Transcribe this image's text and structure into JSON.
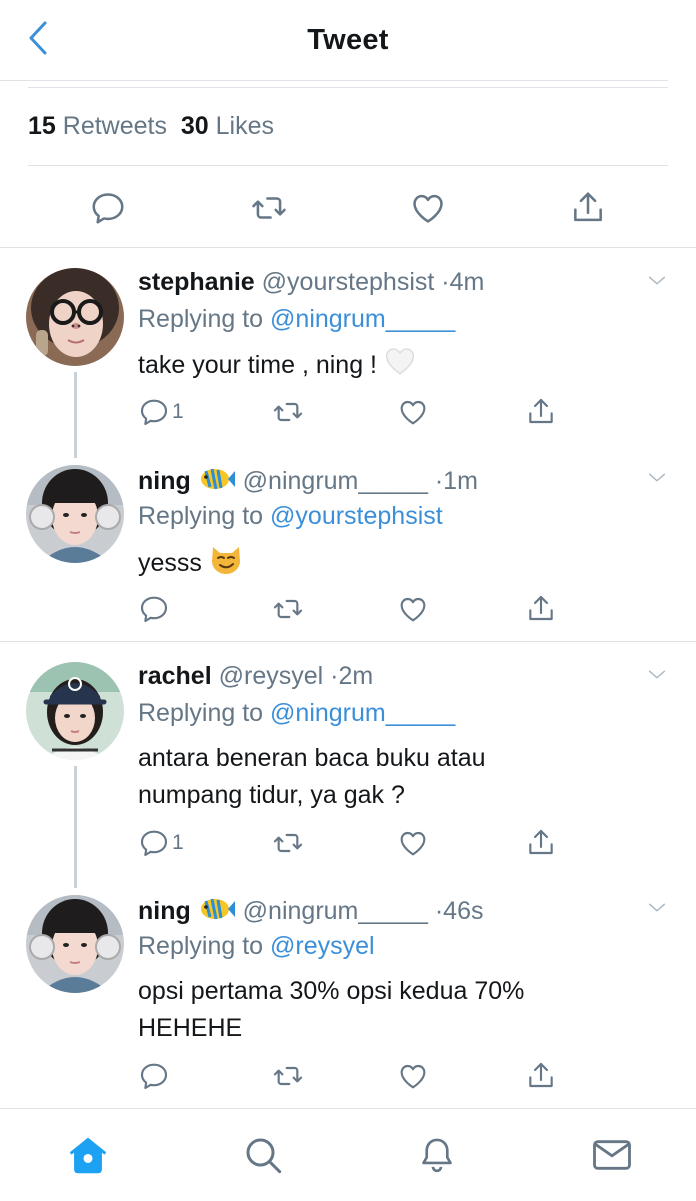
{
  "header": {
    "title": "Tweet"
  },
  "stats": {
    "retweets_count": "15",
    "retweets_label": "Retweets",
    "likes_count": "30",
    "likes_label": "Likes"
  },
  "replies": [
    {
      "name": "stephanie",
      "handle": "@yourstephsist",
      "time": "4m",
      "replying_label": "Replying to",
      "replying_to": "@ningrum_____",
      "text": "take your time , ning !",
      "reply_count": "1",
      "emoji": "white-heart"
    },
    {
      "name": "ning",
      "handle": "@ningrum_____",
      "time": "1m",
      "replying_label": "Replying to",
      "replying_to": "@yourstephsist",
      "text": "yesss",
      "reply_count": "",
      "emoji": "smirking-cat",
      "name_emoji": "tropical-fish"
    },
    {
      "name": "rachel",
      "handle": "@reysyel",
      "time": "2m",
      "replying_label": "Replying to",
      "replying_to": "@ningrum_____",
      "text_lines": [
        "antara beneran baca buku atau",
        "numpang tidur, ya gak ?"
      ],
      "reply_count": "1"
    },
    {
      "name": "ning",
      "handle": "@ningrum_____",
      "time": "46s",
      "replying_label": "Replying to",
      "replying_to": "@reysyel",
      "text_lines": [
        "opsi pertama 30% opsi kedua 70%",
        "HEHEHE"
      ],
      "reply_count": "",
      "name_emoji": "tropical-fish"
    }
  ],
  "icons": {
    "back": "chevron-left-icon",
    "reply": "speech-bubble-icon",
    "retweet": "retweet-arrows-icon",
    "like": "heart-icon",
    "share": "share-upload-icon",
    "more": "chevron-down-icon",
    "tab_home": "home-icon",
    "tab_search": "search-icon",
    "tab_notifications": "bell-icon",
    "tab_messages": "envelope-icon"
  },
  "colors": {
    "accent": "#1da1f2",
    "mention": "#3b8fd9",
    "muted": "#657786",
    "text": "#14171a",
    "divider": "#dfe3e8"
  }
}
